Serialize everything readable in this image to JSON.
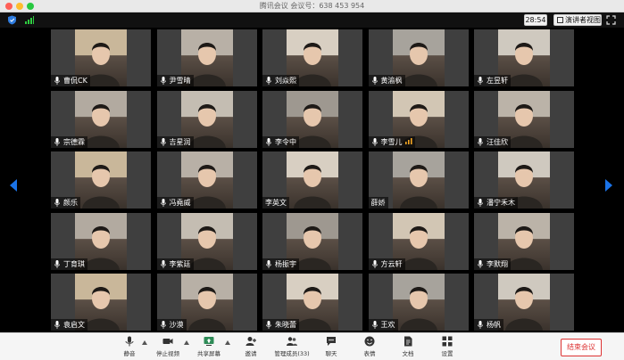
{
  "window": {
    "title": "腾讯会议 会议号：638 453 954"
  },
  "topbar": {
    "timer": "28:54",
    "speaker_view_label": "演讲者视图"
  },
  "participants": [
    {
      "name": "曹侃CK",
      "mic": true,
      "host": true
    },
    {
      "name": "尹雪晴",
      "mic": true
    },
    {
      "name": "刘焱熙",
      "mic": true
    },
    {
      "name": "黄渝枫",
      "mic": true
    },
    {
      "name": "左昱轩",
      "mic": true
    },
    {
      "name": "宗德霖",
      "mic": true
    },
    {
      "name": "吉星润",
      "mic": true
    },
    {
      "name": "李令中",
      "mic": true
    },
    {
      "name": "李雪儿",
      "mic": true,
      "speaking": true
    },
    {
      "name": "汪佳欣",
      "mic": true
    },
    {
      "name": "颜乐",
      "mic": true
    },
    {
      "name": "冯堯威",
      "mic": true
    },
    {
      "name": "李英文",
      "mic": false
    },
    {
      "name": "薛娇",
      "mic": false
    },
    {
      "name": "潘宁禾木",
      "mic": true
    },
    {
      "name": "丁育琪",
      "mic": true
    },
    {
      "name": "李紫廷",
      "mic": true
    },
    {
      "name": "杨振宇",
      "mic": true
    },
    {
      "name": "方云轩",
      "mic": true
    },
    {
      "name": "李默翔",
      "mic": true
    },
    {
      "name": "袁启文",
      "mic": true
    },
    {
      "name": "沙漠",
      "mic": true
    },
    {
      "name": "朱晓蕾",
      "mic": true
    },
    {
      "name": "王欢",
      "mic": true
    },
    {
      "name": "杨帆",
      "mic": true
    }
  ],
  "toolbar": {
    "mute": "静音",
    "stop_video": "停止视频",
    "share_screen": "共享屏幕",
    "invite": "邀请",
    "manage_members": "管理成员(33)",
    "chat": "聊天",
    "reactions": "表情",
    "docs": "文档",
    "settings": "设置",
    "end_meeting": "结束会议"
  },
  "colors": {
    "accent": "#1a73e8",
    "end": "#dd3333"
  }
}
